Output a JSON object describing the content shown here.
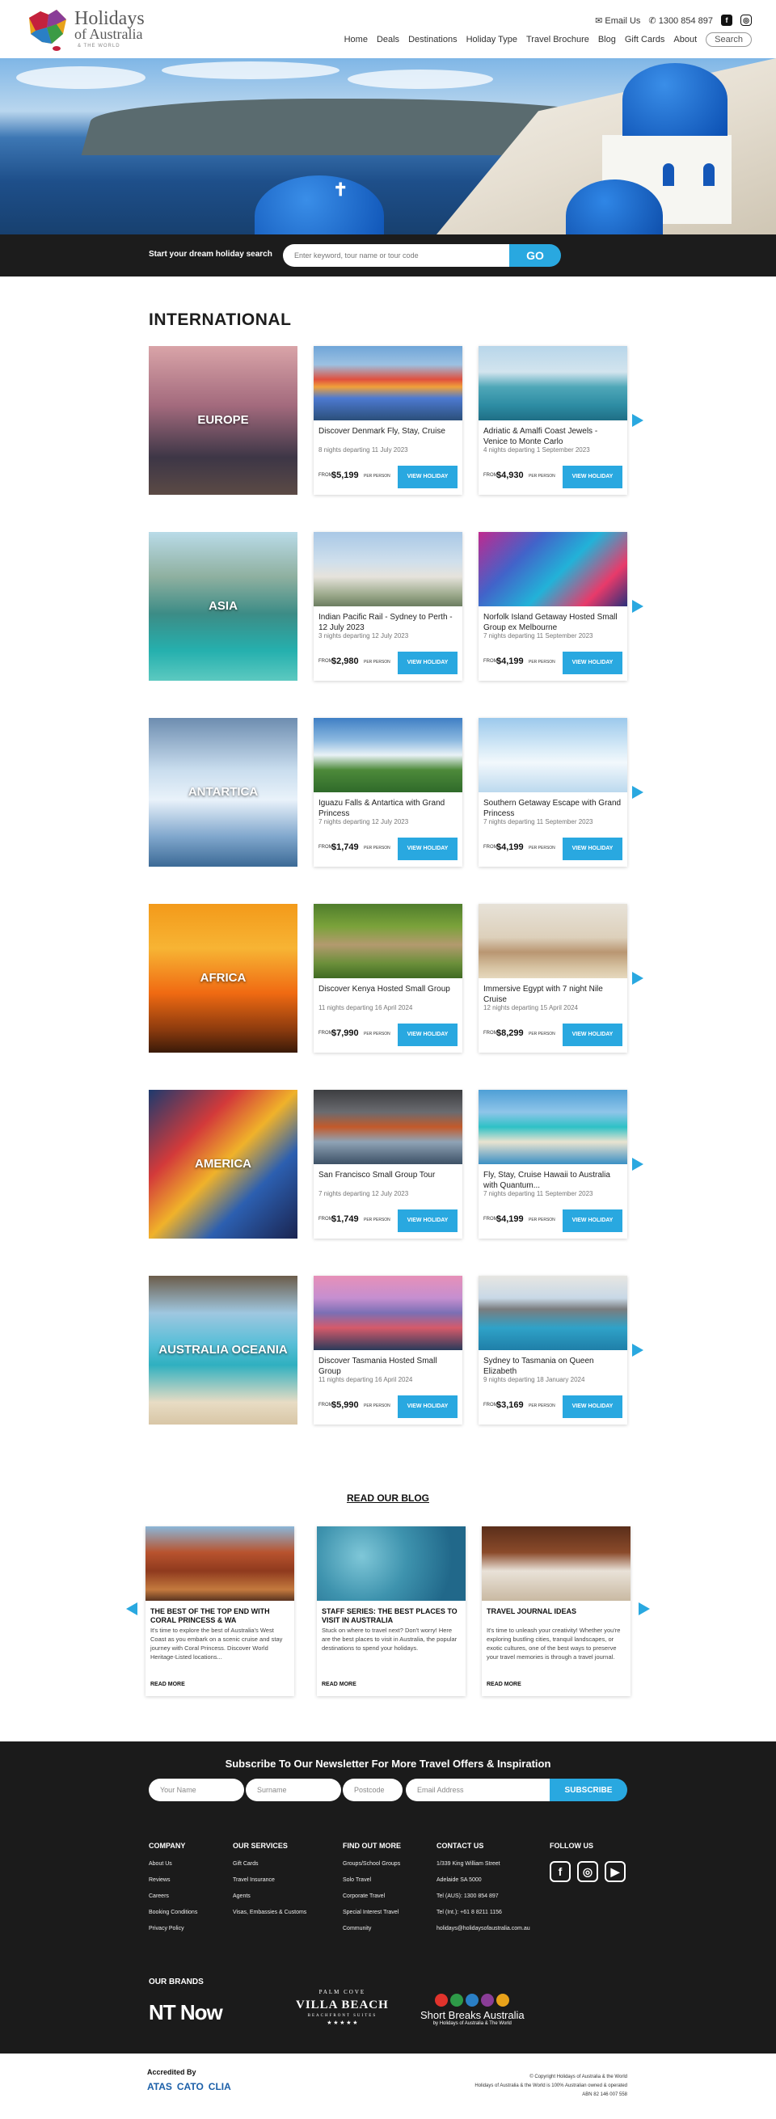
{
  "header": {
    "logo_line1": "Holidays",
    "logo_line2": "of Australia",
    "logo_line3": "& THE WORLD",
    "email_label": "Email Us",
    "phone": "1300 854 897",
    "nav": [
      "Home",
      "Deals",
      "Destinations",
      "Holiday Type",
      "Travel Brochure",
      "Blog",
      "Gift Cards",
      "About"
    ],
    "search_label": "Search"
  },
  "search": {
    "label": "Start your dream holiday search",
    "placeholder": "Enter keyword, tour name or tour code",
    "button": "GO"
  },
  "international": {
    "title": "INTERNATIONAL",
    "rows": [
      {
        "region": "EUROPE",
        "cards": [
          {
            "title": "Discover Denmark Fly, Stay, Cruise",
            "meta": "8 nights departing 11 July 2023",
            "from": "FROM",
            "price": "$5,199",
            "pp": "PER PERSON",
            "button": "VIEW HOLIDAY"
          },
          {
            "title": "Adriatic & Amalfi Coast Jewels - Venice to Monte Carlo",
            "meta": "4 nights departing 1 September 2023",
            "from": "FROM",
            "price": "$4,930",
            "pp": "PER PERSON",
            "button": "VIEW HOLIDAY"
          }
        ]
      },
      {
        "region": "ASIA",
        "cards": [
          {
            "title": "Indian Pacific Rail - Sydney to Perth - 12 July 2023",
            "meta": "3 nights departing 12 July 2023",
            "from": "FROM",
            "price": "$2,980",
            "pp": "PER PERSON",
            "button": "VIEW HOLIDAY"
          },
          {
            "title": "Norfolk Island Getaway Hosted Small Group ex Melbourne",
            "meta": "7 nights departing 11 September 2023",
            "from": "FROM",
            "price": "$4,199",
            "pp": "PER PERSON",
            "button": "VIEW HOLIDAY"
          }
        ]
      },
      {
        "region": "ANTARTICA",
        "cards": [
          {
            "title": "Iguazu Falls & Antartica with Grand Princess",
            "meta": "7 nights departing 12 July 2023",
            "from": "FROM",
            "price": "$1,749",
            "pp": "PER PERSON",
            "button": "VIEW HOLIDAY"
          },
          {
            "title": "Southern Getaway Escape with Grand Princess",
            "meta": "7 nights departing 11 September 2023",
            "from": "FROM",
            "price": "$4,199",
            "pp": "PER PERSON",
            "button": "VIEW HOLIDAY"
          }
        ]
      },
      {
        "region": "AFRICA",
        "cards": [
          {
            "title": "Discover Kenya Hosted Small Group",
            "meta": "11 nights departing 16 April 2024",
            "from": "FROM",
            "price": "$7,990",
            "pp": "PER PERSON",
            "button": "VIEW HOLIDAY"
          },
          {
            "title": "Immersive Egypt with 7 night Nile Cruise",
            "meta": "12 nights departing 15 April 2024",
            "from": "FROM",
            "price": "$8,299",
            "pp": "PER PERSON",
            "button": "VIEW HOLIDAY"
          }
        ]
      },
      {
        "region": "AMERICA",
        "cards": [
          {
            "title": "San Francisco Small Group Tour",
            "meta": "7 nights departing 12 July 2023",
            "from": "FROM",
            "price": "$1,749",
            "pp": "PER PERSON",
            "button": "VIEW HOLIDAY"
          },
          {
            "title": "Fly, Stay, Cruise Hawaii to Australia with Quantum...",
            "meta": "7 nights departing 11 September 2023",
            "from": "FROM",
            "price": "$4,199",
            "pp": "PER PERSON",
            "button": "VIEW HOLIDAY"
          }
        ]
      },
      {
        "region": "AUSTRALIA OCEANIA",
        "cards": [
          {
            "title": "Discover Tasmania Hosted Small Group",
            "meta": "11 nights departing 16 April 2024",
            "from": "FROM",
            "price": "$5,990",
            "pp": "PER PERSON",
            "button": "VIEW HOLIDAY"
          },
          {
            "title": "Sydney to Tasmania on Queen Elizabeth",
            "meta": "9 nights departing 18 January 2024",
            "from": "FROM",
            "price": "$3,169",
            "pp": "PER PERSON",
            "button": "VIEW HOLIDAY"
          }
        ]
      }
    ]
  },
  "blog": {
    "title": "READ OUR BLOG",
    "posts": [
      {
        "title": "THE BEST OF THE TOP END WITH CORAL PRINCESS & WA",
        "excerpt": "It's time to explore the best of Australia's West Coast as you embark on a scenic cruise and stay journey with Coral Princess. Discover World Heritage-Listed locations...",
        "read_more": "READ MORE"
      },
      {
        "title": "STAFF SERIES: THE BEST PLACES TO VISIT IN AUSTRALIA",
        "excerpt": "Stuck on where to travel next? Don't worry! Here are the best places to visit in Australia, the popular destinations to spend your holidays.",
        "read_more": "READ MORE"
      },
      {
        "title": "TRAVEL JOURNAL IDEAS",
        "excerpt": "It's time to unleash your creativity! Whether you're exploring bustling cities, tranquil landscapes, or exotic cultures, one of the best ways to preserve your travel memories is through a travel journal.",
        "read_more": "READ MORE"
      }
    ]
  },
  "newsletter": {
    "title": "Subscribe To Our Newsletter For More Travel Offers & Inspiration",
    "name_placeholder": "Your Name",
    "surname_placeholder": "Surname",
    "postcode_placeholder": "Postcode",
    "email_placeholder": "Email Address",
    "button": "SUBSCRIBE"
  },
  "footer": {
    "company": {
      "heading": "COMPANY",
      "links": [
        "About Us",
        "Reviews",
        "Careers",
        "Booking Conditions",
        "Privacy Policy"
      ]
    },
    "services": {
      "heading": "OUR SERVICES",
      "links": [
        "Gift Cards",
        "Travel Insurance",
        "Agents",
        "Visas, Embassies & Customs"
      ]
    },
    "more": {
      "heading": "FIND OUT MORE",
      "links": [
        "Groups/School Groups",
        "Solo Travel",
        "Corporate Travel",
        "Special Interest Travel",
        "Community"
      ]
    },
    "contact": {
      "heading": "CONTACT US",
      "links": [
        "1/339 King William Street",
        "Adelaide SA 5000",
        "Tel (AUS): 1300 854 897",
        "Tel (Int.): +61 8 8211 1156",
        "holidays@holidaysofaustralia.com.au"
      ]
    },
    "follow": {
      "heading": "FOLLOW US"
    },
    "brands_heading": "OUR BRANDS",
    "brand_nt": "NT Now",
    "brand_villa_top": "PALM COVE",
    "brand_villa_main": "VILLA BEACH",
    "brand_villa_sub": "BEACHFRONT SUITES",
    "brand_short": "Short Breaks Australia",
    "brand_short_sub": "by Holidays of Australia & The World"
  },
  "bottom": {
    "accredited": "Accredited By",
    "logos": [
      "ATAS",
      "CATO",
      "CLIA"
    ],
    "copyright1": "© Copyright Holidays of Australia & the World",
    "copyright2": "Holidays of Australia & the World is 100% Australian owned & operated",
    "copyright3": "ABN 82 146 007 558"
  },
  "colors": {
    "accent": "#29a8e0",
    "dark": "#1b1b1b"
  }
}
